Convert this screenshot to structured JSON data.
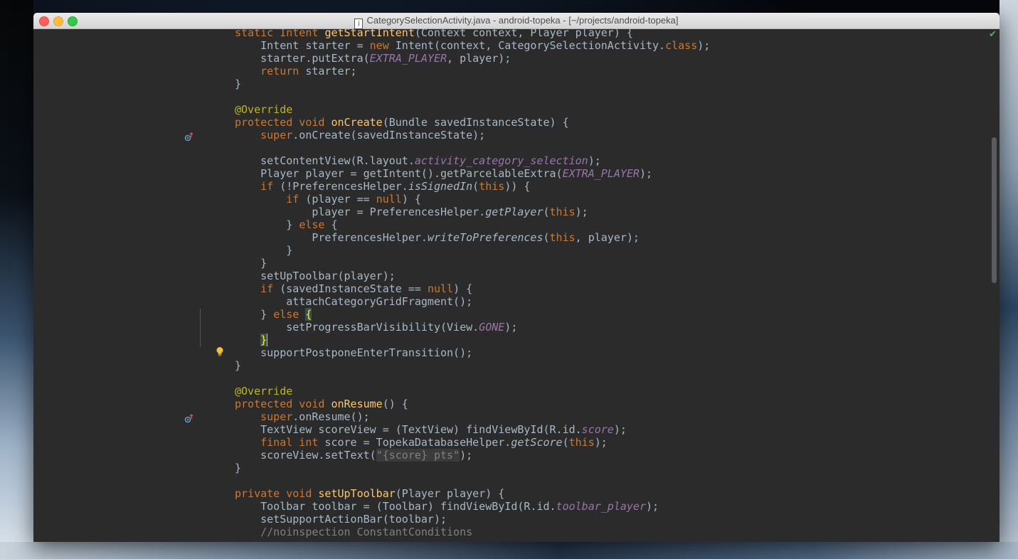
{
  "window": {
    "title": "CategorySelectionActivity.java - android-topeka - [~/projects/android-topeka]",
    "file_icon_letter": "j"
  },
  "status": {
    "inspection_ok_icon": "check-icon",
    "inspection_ok_color": "#59a869"
  },
  "colors": {
    "background": "#2b2b2b",
    "keyword": "#cc7832",
    "annotation": "#bbb529",
    "method_decl": "#ffc66d",
    "field": "#9876aa",
    "comment": "#808080",
    "text": "#a9b7c6"
  },
  "code": {
    "lines": [
      [
        {
          "t": "static Intent ",
          "c": "kw0"
        },
        {
          "t": "getStartIntent",
          "c": "fn"
        },
        {
          "t": "(Context context, Player player) {"
        }
      ],
      [
        {
          "t": "    Intent starter = "
        },
        {
          "t": "new",
          "c": "kw"
        },
        {
          "t": " Intent(context, CategorySelectionActivity."
        },
        {
          "t": "class",
          "c": "kw"
        },
        {
          "t": ");"
        }
      ],
      [
        {
          "t": "    starter.putExtra("
        },
        {
          "t": "EXTRA_PLAYER",
          "c": "it"
        },
        {
          "t": ", player);"
        }
      ],
      [
        {
          "t": "    "
        },
        {
          "t": "return",
          "c": "kw"
        },
        {
          "t": " starter;"
        }
      ],
      [
        {
          "t": "}"
        }
      ],
      [],
      [
        {
          "t": "@Override",
          "c": "ann"
        }
      ],
      [
        {
          "t": "protected void ",
          "c": "kw"
        },
        {
          "t": "onCreate",
          "c": "fn"
        },
        {
          "t": "(Bundle savedInstanceState) {"
        }
      ],
      [
        {
          "t": "    "
        },
        {
          "t": "super",
          "c": "kw"
        },
        {
          "t": ".onCreate(savedInstanceState);"
        }
      ],
      [],
      [
        {
          "t": "    setContentView(R.layout."
        },
        {
          "t": "activity_category_selection",
          "c": "it"
        },
        {
          "t": ");"
        }
      ],
      [
        {
          "t": "    Player player = getIntent().getParcelableExtra("
        },
        {
          "t": "EXTRA_PLAYER",
          "c": "it"
        },
        {
          "t": ");"
        }
      ],
      [
        {
          "t": "    "
        },
        {
          "t": "if",
          "c": "kw"
        },
        {
          "t": " (!PreferencesHelper."
        },
        {
          "t": "isSignedIn",
          "c": "stat"
        },
        {
          "t": "("
        },
        {
          "t": "this",
          "c": "kw"
        },
        {
          "t": ")) {"
        }
      ],
      [
        {
          "t": "        "
        },
        {
          "t": "if",
          "c": "kw"
        },
        {
          "t": " (player == "
        },
        {
          "t": "null",
          "c": "kw"
        },
        {
          "t": ") {"
        }
      ],
      [
        {
          "t": "            player = PreferencesHelper."
        },
        {
          "t": "getPlayer",
          "c": "stat"
        },
        {
          "t": "("
        },
        {
          "t": "this",
          "c": "kw"
        },
        {
          "t": ");"
        }
      ],
      [
        {
          "t": "        } "
        },
        {
          "t": "else",
          "c": "kw"
        },
        {
          "t": " {"
        }
      ],
      [
        {
          "t": "            PreferencesHelper."
        },
        {
          "t": "writeToPreferences",
          "c": "stat"
        },
        {
          "t": "("
        },
        {
          "t": "this",
          "c": "kw"
        },
        {
          "t": ", player);"
        }
      ],
      [
        {
          "t": "        }"
        }
      ],
      [
        {
          "t": "    }"
        }
      ],
      [
        {
          "t": "    setUpToolbar(player);"
        }
      ],
      [
        {
          "t": "    "
        },
        {
          "t": "if",
          "c": "kw"
        },
        {
          "t": " (savedInstanceState == "
        },
        {
          "t": "null",
          "c": "kw"
        },
        {
          "t": ") {"
        }
      ],
      [
        {
          "t": "        attachCategoryGridFragment();"
        }
      ],
      [
        {
          "t": "    } "
        },
        {
          "t": "else",
          "c": "kw"
        },
        {
          "t": " "
        },
        {
          "t": "{",
          "c": "bracket"
        }
      ],
      [
        {
          "t": "        setProgressBarVisibility(View."
        },
        {
          "t": "GONE",
          "c": "it"
        },
        {
          "t": ");"
        }
      ],
      [
        {
          "t": "    "
        },
        {
          "t": "}",
          "c": "bracket"
        },
        {
          "t": "",
          "c": "caret"
        }
      ],
      [
        {
          "t": "    supportPostponeEnterTransition();"
        }
      ],
      [
        {
          "t": "}"
        }
      ],
      [],
      [
        {
          "t": "@Override",
          "c": "ann"
        }
      ],
      [
        {
          "t": "protected void ",
          "c": "kw"
        },
        {
          "t": "onResume",
          "c": "fn"
        },
        {
          "t": "() {"
        }
      ],
      [
        {
          "t": "    "
        },
        {
          "t": "super",
          "c": "kw"
        },
        {
          "t": ".onResume();"
        }
      ],
      [
        {
          "t": "    TextView scoreView = (TextView) findViewById(R.id."
        },
        {
          "t": "score",
          "c": "it"
        },
        {
          "t": ");"
        }
      ],
      [
        {
          "t": "    "
        },
        {
          "t": "final int",
          "c": "kw"
        },
        {
          "t": " score = TopekaDatabaseHelper."
        },
        {
          "t": "getScore",
          "c": "stat"
        },
        {
          "t": "("
        },
        {
          "t": "this",
          "c": "kw"
        },
        {
          "t": ");"
        }
      ],
      [
        {
          "t": "    scoreView.setText("
        },
        {
          "t": "\"{score} pts\"",
          "c": "fold"
        },
        {
          "t": ");"
        }
      ],
      [
        {
          "t": "}"
        }
      ],
      [],
      [
        {
          "t": "private void ",
          "c": "kw"
        },
        {
          "t": "setUpToolbar",
          "c": "fn"
        },
        {
          "t": "(Player player) {"
        }
      ],
      [
        {
          "t": "    Toolbar toolbar = (Toolbar) findViewById(R.id."
        },
        {
          "t": "toolbar_player",
          "c": "it"
        },
        {
          "t": ");"
        }
      ],
      [
        {
          "t": "    setSupportActionBar(toolbar);"
        }
      ],
      [
        {
          "t": "    "
        },
        {
          "t": "//noinspection ConstantConditions",
          "c": "cmt"
        }
      ]
    ]
  },
  "gutter": {
    "override_icon": "override-marker-icon",
    "intention_icon": "lightbulb-icon"
  }
}
